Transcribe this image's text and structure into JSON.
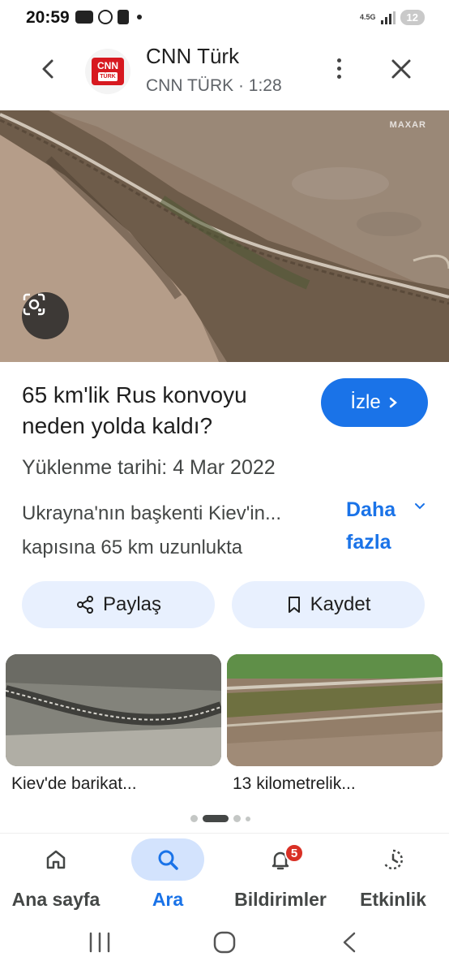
{
  "status_bar": {
    "time": "20:59",
    "network": "4.5G",
    "battery": "12"
  },
  "header": {
    "channel_name": "CNN Türk",
    "channel_sub": "CNN TÜRK · 1:28",
    "logo_text": "CNN",
    "logo_sub": "TÜRK"
  },
  "hero": {
    "watermark": "MAXAR"
  },
  "video": {
    "title": "65 km'lik Rus konvoyu neden yolda kaldı?",
    "watch_label": "İzle",
    "upload_date": "Yüklenme tarihi: 4 Mar 2022",
    "desc_line1": "Ukrayna'nın başkenti Kiev'in...",
    "desc_line2": "kapısına 65 km uzunlukta",
    "more_label": "Daha fazla"
  },
  "actions": {
    "share_label": "Paylaş",
    "save_label": "Kaydet"
  },
  "related": [
    {
      "label": "Kiev'de barikat..."
    },
    {
      "label": "13 kilometrelik..."
    }
  ],
  "bottom_nav": {
    "items": [
      {
        "label": "Ana sayfa",
        "icon": "home-icon"
      },
      {
        "label": "Ara",
        "icon": "search-icon",
        "active": true
      },
      {
        "label": "Bildirimler",
        "icon": "bell-icon",
        "badge": "5"
      },
      {
        "label": "Etkinlik",
        "icon": "activity-icon"
      }
    ]
  },
  "colors": {
    "accent": "#1a73e8",
    "chip_bg": "#e8f0fe",
    "badge": "#d93025"
  }
}
